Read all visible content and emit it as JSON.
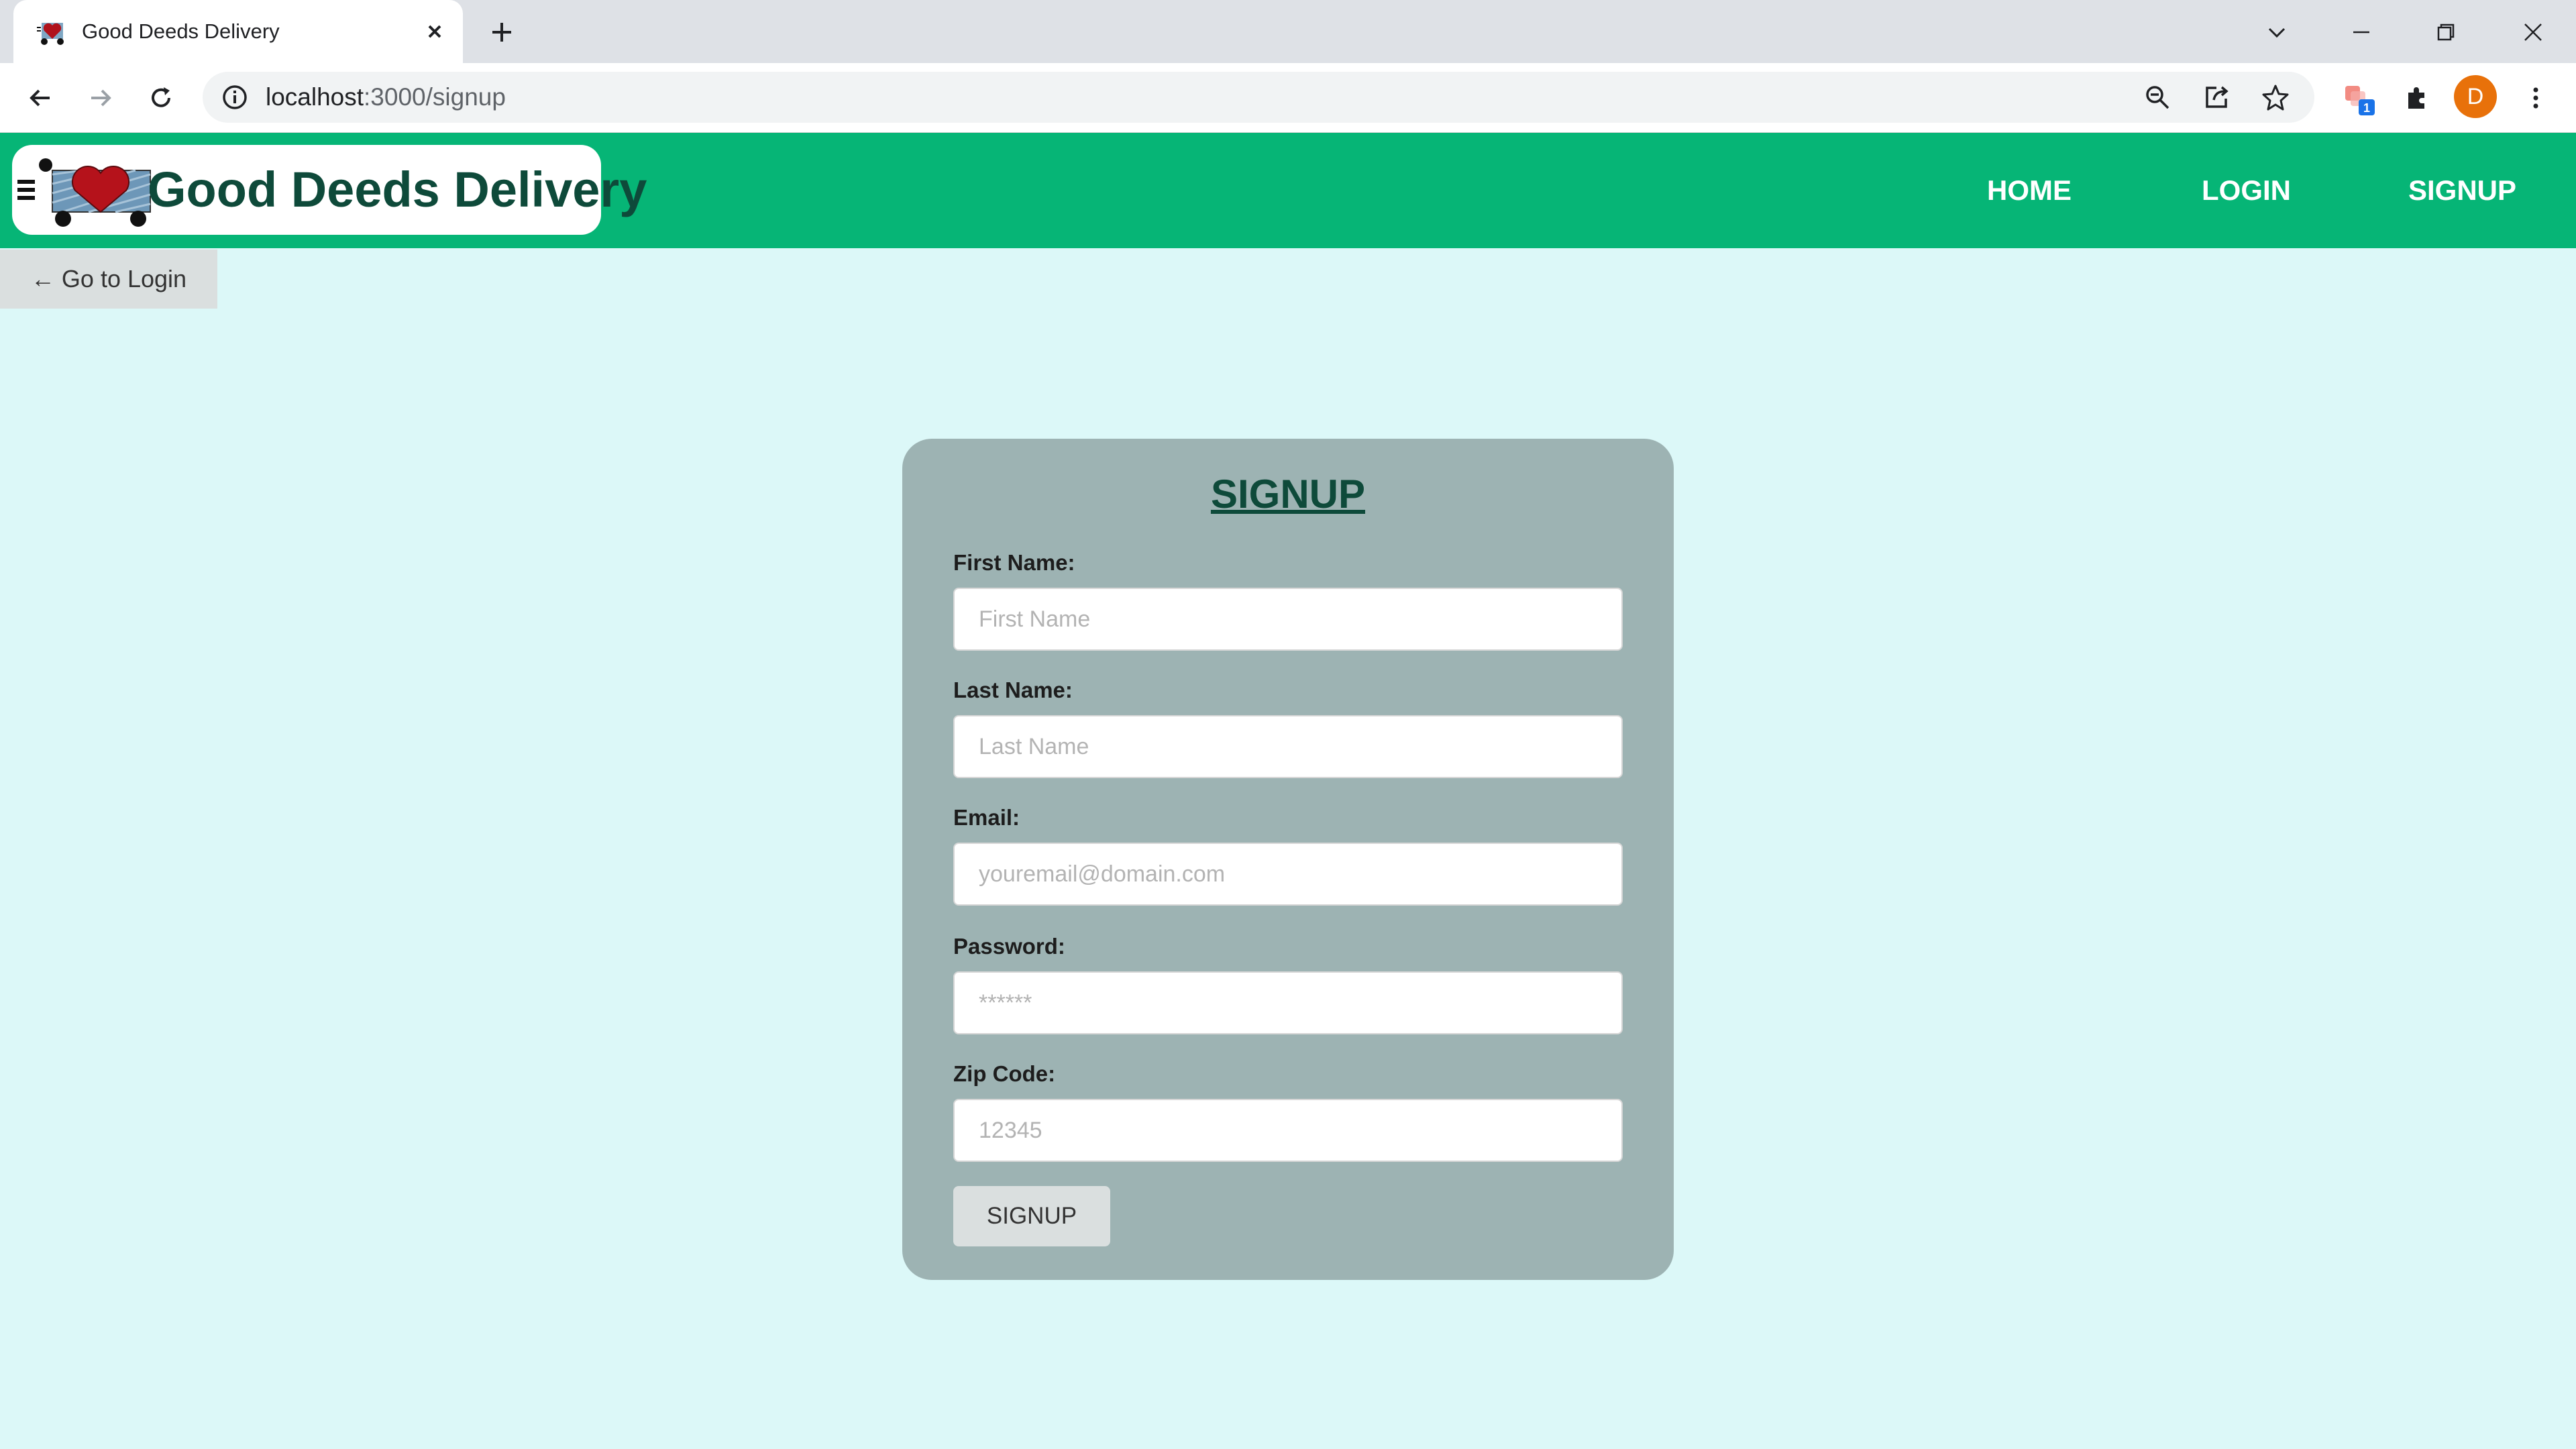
{
  "browser": {
    "tab_title": "Good Deeds Delivery",
    "url_host": "localhost",
    "url_path": ":3000/signup",
    "profile_initial": "D",
    "extension_badge": "1"
  },
  "site": {
    "brand_name": "Good Deeds Delivery",
    "nav": [
      {
        "label": "HOME"
      },
      {
        "label": "LOGIN"
      },
      {
        "label": "SIGNUP"
      }
    ]
  },
  "page": {
    "back_link": "← Go to Login",
    "form": {
      "title": "SIGNUP",
      "fields": [
        {
          "label": "First Name:",
          "placeholder": "First Name",
          "value": ""
        },
        {
          "label": "Last Name:",
          "placeholder": "Last Name",
          "value": ""
        },
        {
          "label": "Email:",
          "placeholder": "youremail@domain.com",
          "value": ""
        },
        {
          "label": "Password:",
          "placeholder": "******",
          "value": ""
        },
        {
          "label": "Zip Code:",
          "placeholder": "12345",
          "value": ""
        }
      ],
      "submit_label": "SIGNUP"
    }
  },
  "colors": {
    "header_green": "#06b576",
    "page_bg": "#dcf8f8",
    "card_bg": "#9db3b3",
    "brand_text": "#0e4a3a"
  }
}
